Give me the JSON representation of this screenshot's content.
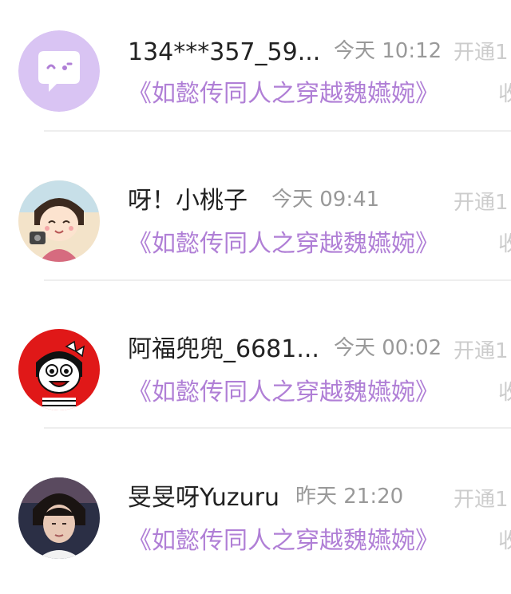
{
  "rows": [
    {
      "name": "134***357_59...",
      "time": "今天 10:12",
      "status": "开通1",
      "book": "《如懿传同人之穿越魏嬿婉》",
      "side": "收",
      "avatar": "default-chat-avatar",
      "accent": "#b07fd6"
    },
    {
      "name": "呀！小桃子",
      "time": "今天 09:41",
      "status": "开通1",
      "book": "《如懿传同人之穿越魏嬿婉》",
      "side": "收",
      "avatar": "anime-girl-avatar"
    },
    {
      "name": "阿福兜兜_6681...",
      "time": "今天 00:02",
      "status": "开通1",
      "book": "《如懿传同人之穿越魏嬿婉》",
      "side": "收",
      "avatar": "cartoon-girl-avatar"
    },
    {
      "name": "旻旻呀Yuzuru",
      "time": "昨天 21:20",
      "status": "开通1",
      "book": "《如懿传同人之穿越魏嬿婉》",
      "side": "收",
      "avatar": "photo-avatar"
    }
  ]
}
